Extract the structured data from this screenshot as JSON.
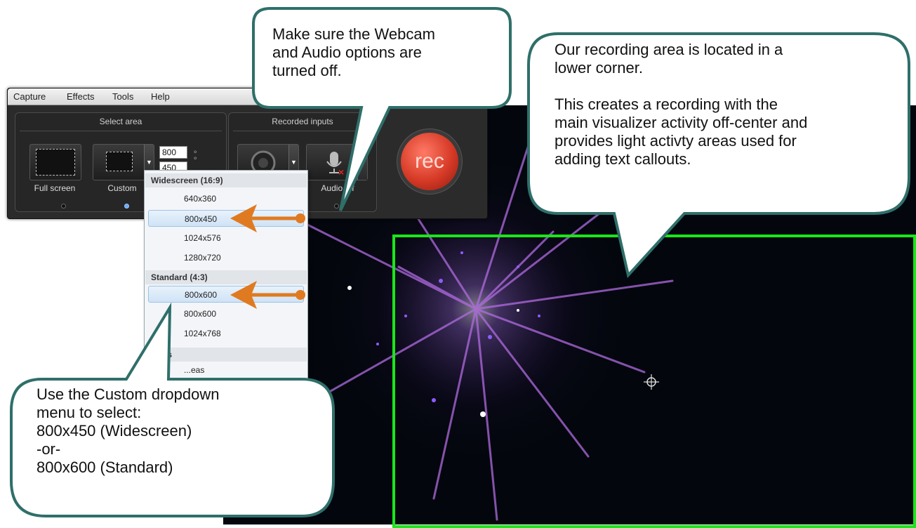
{
  "menu": [
    "Capture",
    "Effects",
    "Tools",
    "Help"
  ],
  "select_area": {
    "title": "Select area",
    "full_screen_label": "Full screen",
    "custom_label": "Custom",
    "width_value": "800",
    "height_value": "450"
  },
  "recorded_inputs": {
    "title": "Recorded inputs",
    "audio_label": "Audio off"
  },
  "rec_label": "rec",
  "dropdown": {
    "widescreen_header": "Widescreen (16:9)",
    "widescreen_items": [
      "640x360",
      "800x450",
      "1024x576",
      "1280x720"
    ],
    "standard_header": "Standard (4:3)",
    "standard_items": [
      "800x600",
      "800x600",
      "1024x768"
    ],
    "partial_header": "...eas",
    "partial_item": "...eas"
  },
  "callouts": {
    "top": "Make sure the Webcam\nand Audio options are\nturned off.",
    "right": "Our recording area is located in a\nlower corner.\n\nThis creates a recording with the\nmain visualizer activity off-center and\nprovides light activty areas used for\nadding text callouts.",
    "bottom": "Use the Custom dropdown\nmenu to select:\n800x450 (Widescreen)\n-or-\n 800x600 (Standard)"
  },
  "colors": {
    "callout_fill": "#ffffff",
    "callout_border": "#2f6f6a",
    "arrow": "#e07a20",
    "recording_frame": "#19e619",
    "rec_button": "#d63a26",
    "visualizer_bg": "#03070d"
  }
}
